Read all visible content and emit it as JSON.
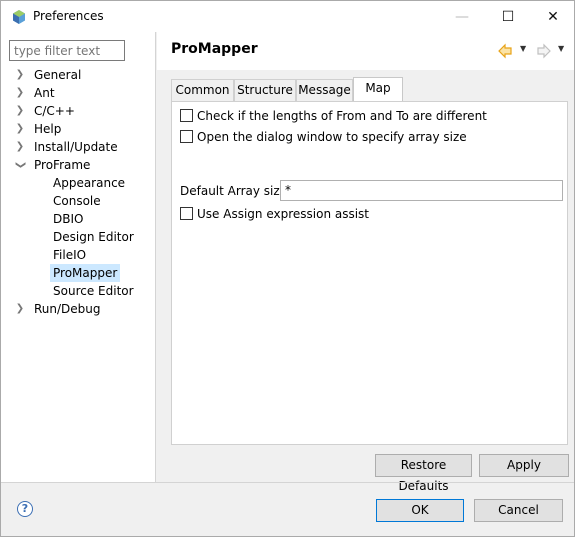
{
  "window": {
    "title": "Preferences",
    "minimize_glyph": "—",
    "maximize_glyph": "☐",
    "close_glyph": "✕"
  },
  "sidebar": {
    "filter_placeholder": "type filter text",
    "items": [
      {
        "label": "General",
        "expandable": true,
        "expanded": false
      },
      {
        "label": "Ant",
        "expandable": true,
        "expanded": false
      },
      {
        "label": "C/C++",
        "expandable": true,
        "expanded": false
      },
      {
        "label": "Help",
        "expandable": true,
        "expanded": false
      },
      {
        "label": "Install/Update",
        "expandable": true,
        "expanded": false
      },
      {
        "label": "ProFrame",
        "expandable": true,
        "expanded": true
      },
      {
        "label": "Appearance",
        "child": true
      },
      {
        "label": "Console",
        "child": true
      },
      {
        "label": "DBIO",
        "child": true
      },
      {
        "label": "Design Editor",
        "child": true
      },
      {
        "label": "FileIO",
        "child": true
      },
      {
        "label": "ProMapper",
        "child": true,
        "selected": true
      },
      {
        "label": "Source Editor",
        "child": true
      },
      {
        "label": "Run/Debug",
        "expandable": true,
        "expanded": false
      }
    ]
  },
  "page": {
    "title": "ProMapper",
    "tabs": [
      "Common",
      "Structure",
      "Message",
      "Map"
    ],
    "active_tab": "Map",
    "options": {
      "check_lengths": {
        "label": "Check if the lengths of From and To are different",
        "checked": false
      },
      "open_dialog": {
        "label": "Open the dialog window to specify array size",
        "checked": false
      },
      "default_array_size": {
        "label": "Default Array size",
        "value": "*"
      },
      "assign_assist": {
        "label": "Use Assign expression assist",
        "checked": false
      }
    },
    "restore_defaults_label": "Restore Defaults",
    "apply_label": "Apply"
  },
  "footer": {
    "help_glyph": "?",
    "ok_label": "OK",
    "cancel_label": "Cancel"
  },
  "colors": {
    "selection": "#cce8ff",
    "primary_border": "#0078d7",
    "back_arrow": "#e8a317",
    "forward_arrow": "#c0c0c0"
  }
}
